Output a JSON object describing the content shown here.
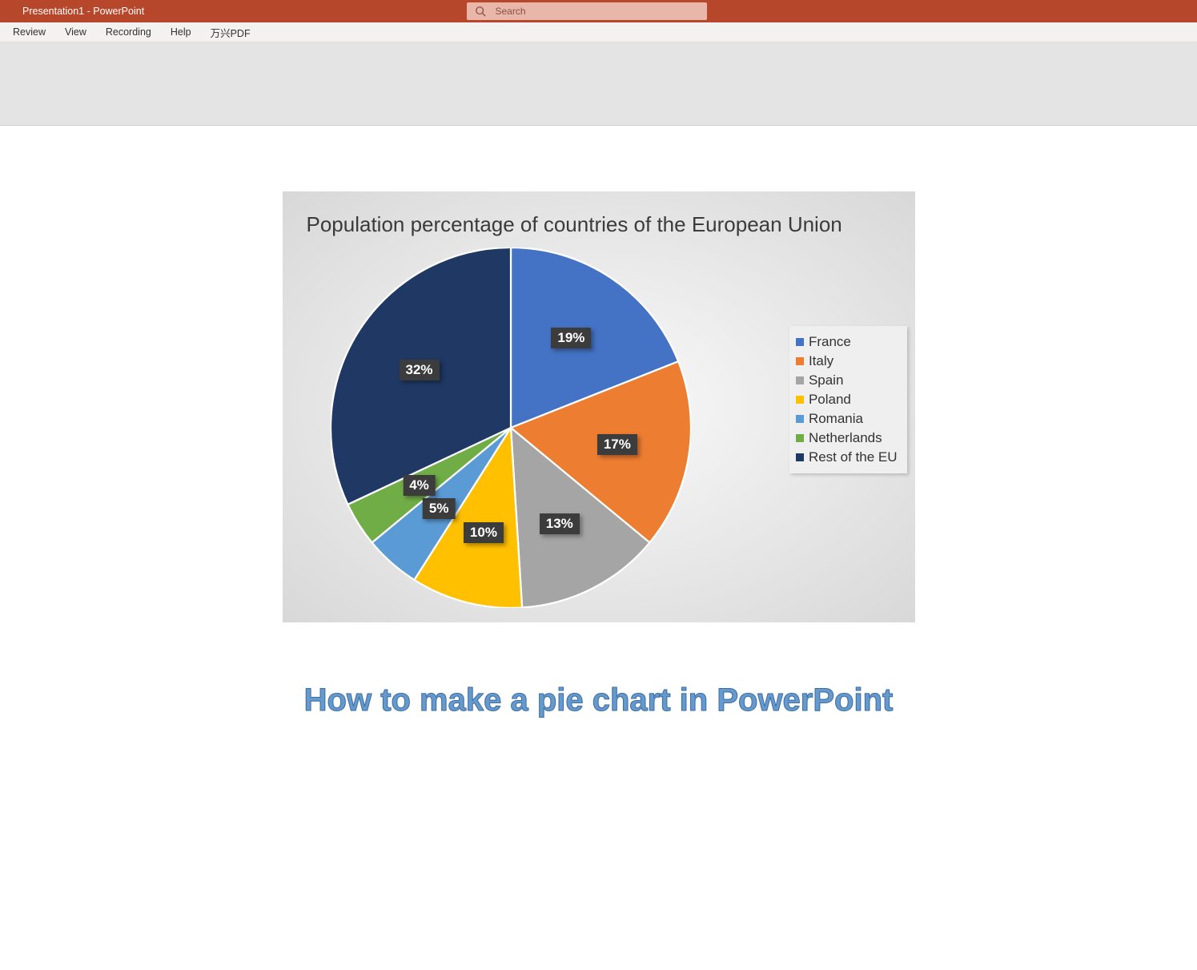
{
  "title_bar": {
    "doc_title": "Presentation1  -  PowerPoint",
    "search_placeholder": "Search"
  },
  "ribbon_tabs": [
    "Review",
    "View",
    "Recording",
    "Help",
    "万兴PDF"
  ],
  "chart_data": {
    "type": "pie",
    "title": "Population percentage of countries of the European Union",
    "series": [
      {
        "name": "France",
        "value": 19,
        "label": "19%",
        "color": "#4472c4"
      },
      {
        "name": "Italy",
        "value": 17,
        "label": "17%",
        "color": "#ed7d31"
      },
      {
        "name": "Spain",
        "value": 13,
        "label": "13%",
        "color": "#a5a5a5"
      },
      {
        "name": "Poland",
        "value": 10,
        "label": "10%",
        "color": "#ffc000"
      },
      {
        "name": "Romania",
        "value": 5,
        "label": "5%",
        "color": "#5b9bd5"
      },
      {
        "name": "Netherlands",
        "value": 4,
        "label": "4%",
        "color": "#70ad47"
      },
      {
        "name": "Rest of the EU",
        "value": 32,
        "label": "32%",
        "color": "#1f3864"
      }
    ]
  },
  "tutorial_title": "How to make a pie chart in PowerPoint"
}
